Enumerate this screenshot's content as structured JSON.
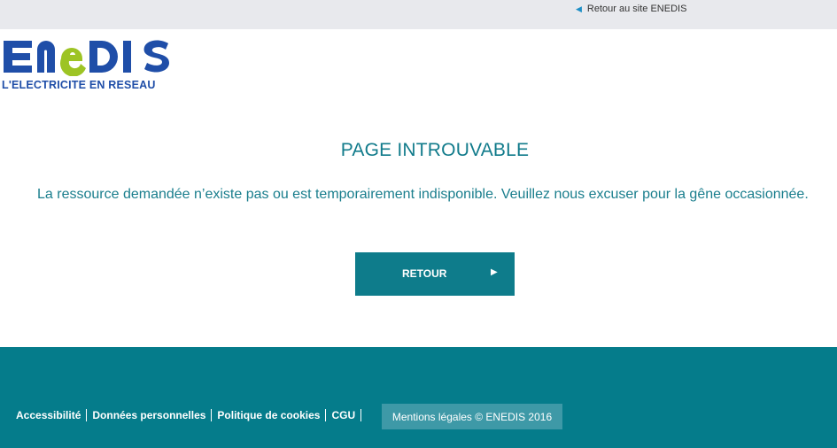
{
  "topbar": {
    "back_link_label": "Retour au site ENEDIS"
  },
  "logo": {
    "brand": "ENEDIS",
    "tagline": "L'ELECTRICITE EN RESEAU"
  },
  "main": {
    "title": "PAGE INTROUVABLE",
    "message": "La ressource demandée n’existe pas ou est temporairement indisponible. Veuillez nous excuser pour la gêne occasionnée.",
    "button_label": "RETOUR"
  },
  "footer": {
    "links": [
      {
        "label": "Accessibilité"
      },
      {
        "label": "Données personnelles"
      },
      {
        "label": "Politique de cookies"
      },
      {
        "label": "CGU"
      }
    ],
    "legal": "Mentions légales © ENEDIS 2016"
  },
  "icons": {
    "back": "triangle-left-icon",
    "button": "play-icon"
  },
  "colors": {
    "teal": "#0e7c8b",
    "logo_blue": "#1f4ea8",
    "logo_green": "#9dc424",
    "topbar_bg": "#e8e9ed"
  }
}
